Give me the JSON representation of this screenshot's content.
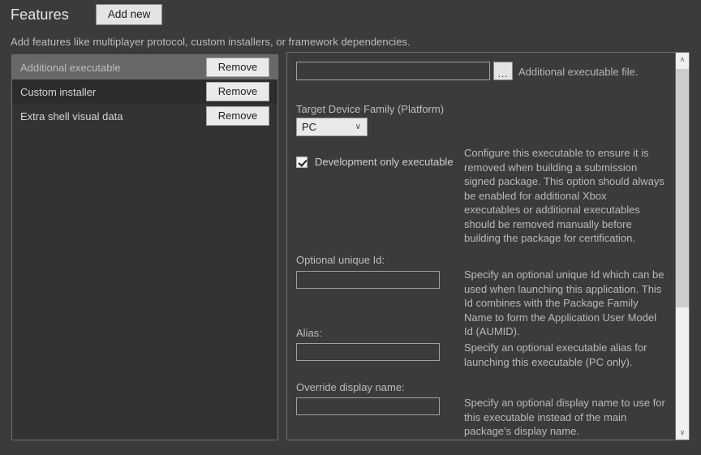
{
  "header": {
    "title": "Features",
    "add_new_label": "Add new",
    "subtitle": "Add features like multiplayer protocol, custom installers, or framework dependencies."
  },
  "feature_list": {
    "items": [
      {
        "label": "Additional executable",
        "remove_label": "Remove",
        "state": "selected"
      },
      {
        "label": "Custom installer",
        "remove_label": "Remove",
        "state": "hover"
      },
      {
        "label": "Extra shell visual data",
        "remove_label": "Remove",
        "state": "normal"
      }
    ]
  },
  "detail": {
    "executable_file": {
      "value": "",
      "browse_label": "...",
      "description": "Additional executable file."
    },
    "target_device_family": {
      "label": "Target Device Family (Platform)",
      "selected": "PC",
      "options": [
        "PC"
      ],
      "chevron": "∨"
    },
    "development_only": {
      "label": "Development only executable",
      "checked": true,
      "description": "Configure this executable to ensure it is removed when building a submission signed package. This option should always be enabled for additional Xbox executables or additional executables should be removed manually before building the package for certification."
    },
    "optional_unique_id": {
      "label": "Optional unique Id:",
      "value": "",
      "description": "Specify an optional unique Id which can be used when launching this application. This Id combines with the Package Family Name to form the Application User Model Id (AUMID)."
    },
    "alias": {
      "label": "Alias:",
      "value": "",
      "description": "Specify an optional executable alias for launching this executable (PC only)."
    },
    "override_display_name": {
      "label": "Override display name:",
      "value": "",
      "description": "Specify an optional display name to use for this executable instead of the main package's display name."
    },
    "scrollbar": {
      "up_arrow": "∧",
      "down_arrow": "∨"
    }
  },
  "colors": {
    "window_bg": "#3b3b3b",
    "panel_bg": "#333333",
    "panel_border": "#6e6e6e",
    "selected_row": "#686868",
    "button_face": "#e4e4e4",
    "text": "#d4d4d4",
    "muted_text": "#b9b9b9"
  }
}
